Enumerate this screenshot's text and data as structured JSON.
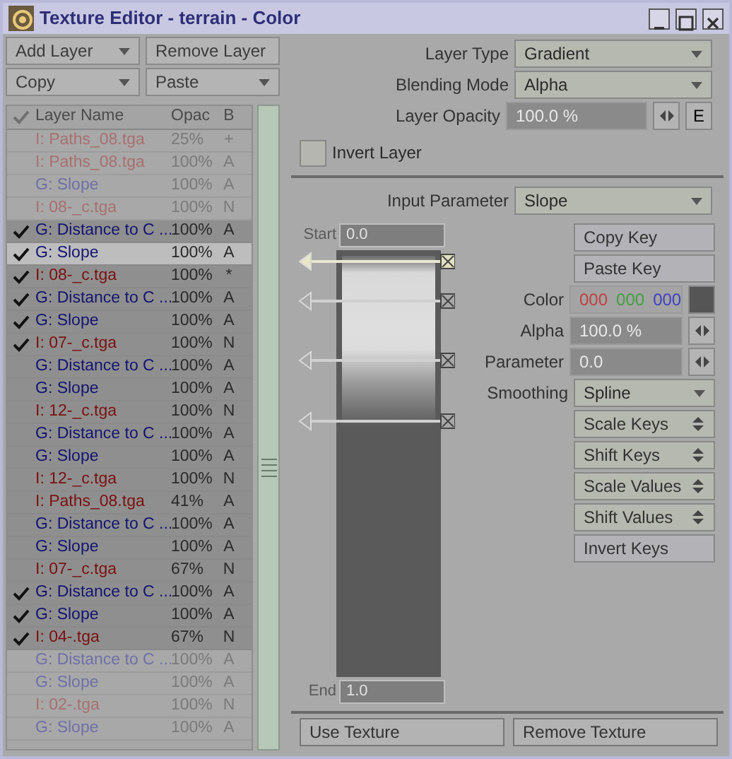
{
  "window": {
    "title": "Texture Editor - terrain - Color"
  },
  "layer_buttons": [
    {
      "label": "Add Layer",
      "kind": "dropdown"
    },
    {
      "label": "Remove Layer",
      "kind": "button"
    },
    {
      "label": "Copy",
      "kind": "dropdown"
    },
    {
      "label": "Paste",
      "kind": "dropdown"
    }
  ],
  "layer_list": {
    "columns": [
      "Layer Name",
      "Opac",
      "B"
    ],
    "rows": [
      {
        "name": "I: Paths_08.tga",
        "opacity": "25%",
        "blend": "+",
        "kind": "image",
        "checked": false,
        "selected": false,
        "dimmed": true
      },
      {
        "name": "I: Paths_08.tga",
        "opacity": "100%",
        "blend": "A",
        "kind": "image",
        "checked": false,
        "selected": false,
        "dimmed": true
      },
      {
        "name": "G: Slope",
        "opacity": "100%",
        "blend": "A",
        "kind": "gradient",
        "checked": false,
        "selected": false,
        "dimmed": true
      },
      {
        "name": "I: 08-_c.tga",
        "opacity": "100%",
        "blend": "N",
        "kind": "image",
        "checked": false,
        "selected": false,
        "dimmed": true
      },
      {
        "name": "G: Distance to C ...",
        "opacity": "100%",
        "blend": "A",
        "kind": "gradient",
        "checked": true,
        "selected": false,
        "dimmed": false
      },
      {
        "name": "G: Slope",
        "opacity": "100%",
        "blend": "A",
        "kind": "gradient",
        "checked": true,
        "selected": true,
        "dimmed": false
      },
      {
        "name": "I: 08-_c.tga",
        "opacity": "100%",
        "blend": "*",
        "kind": "image",
        "checked": true,
        "selected": false,
        "dimmed": false
      },
      {
        "name": "G: Distance to C ...",
        "opacity": "100%",
        "blend": "A",
        "kind": "gradient",
        "checked": true,
        "selected": false,
        "dimmed": false
      },
      {
        "name": "G: Slope",
        "opacity": "100%",
        "blend": "A",
        "kind": "gradient",
        "checked": true,
        "selected": false,
        "dimmed": false
      },
      {
        "name": "I: 07-_c.tga",
        "opacity": "100%",
        "blend": "N",
        "kind": "image",
        "checked": true,
        "selected": false,
        "dimmed": false
      },
      {
        "name": "G: Distance to C ...",
        "opacity": "100%",
        "blend": "A",
        "kind": "gradient",
        "checked": false,
        "selected": false,
        "dimmed": false
      },
      {
        "name": "G: Slope",
        "opacity": "100%",
        "blend": "A",
        "kind": "gradient",
        "checked": false,
        "selected": false,
        "dimmed": false
      },
      {
        "name": "I: 12-_c.tga",
        "opacity": "100%",
        "blend": "N",
        "kind": "image",
        "checked": false,
        "selected": false,
        "dimmed": false
      },
      {
        "name": "G: Distance to C ...",
        "opacity": "100%",
        "blend": "A",
        "kind": "gradient",
        "checked": false,
        "selected": false,
        "dimmed": false
      },
      {
        "name": "G: Slope",
        "opacity": "100%",
        "blend": "A",
        "kind": "gradient",
        "checked": false,
        "selected": false,
        "dimmed": false
      },
      {
        "name": "I: 12-_c.tga",
        "opacity": "100%",
        "blend": "N",
        "kind": "image",
        "checked": false,
        "selected": false,
        "dimmed": false
      },
      {
        "name": "I: Paths_08.tga",
        "opacity": "41%",
        "blend": "A",
        "kind": "image",
        "checked": false,
        "selected": false,
        "dimmed": false
      },
      {
        "name": "G: Distance to C ...",
        "opacity": "100%",
        "blend": "A",
        "kind": "gradient",
        "checked": false,
        "selected": false,
        "dimmed": false
      },
      {
        "name": "G: Slope",
        "opacity": "100%",
        "blend": "A",
        "kind": "gradient",
        "checked": false,
        "selected": false,
        "dimmed": false
      },
      {
        "name": "I: 07-_c.tga",
        "opacity": "67%",
        "blend": "N",
        "kind": "image",
        "checked": false,
        "selected": false,
        "dimmed": false
      },
      {
        "name": "G: Distance to C ...",
        "opacity": "100%",
        "blend": "A",
        "kind": "gradient",
        "checked": true,
        "selected": false,
        "dimmed": false
      },
      {
        "name": "G: Slope",
        "opacity": "100%",
        "blend": "A",
        "kind": "gradient",
        "checked": true,
        "selected": false,
        "dimmed": false
      },
      {
        "name": "I: 04-.tga",
        "opacity": "67%",
        "blend": "N",
        "kind": "image",
        "checked": true,
        "selected": false,
        "dimmed": false
      },
      {
        "name": "G: Distance to C ...",
        "opacity": "100%",
        "blend": "A",
        "kind": "gradient",
        "checked": false,
        "selected": false,
        "dimmed": true
      },
      {
        "name": "G: Slope",
        "opacity": "100%",
        "blend": "A",
        "kind": "gradient",
        "checked": false,
        "selected": false,
        "dimmed": true
      },
      {
        "name": "I: 02-.tga",
        "opacity": "100%",
        "blend": "N",
        "kind": "image",
        "checked": false,
        "selected": false,
        "dimmed": true
      },
      {
        "name": "G: Slope",
        "opacity": "100%",
        "blend": "A",
        "kind": "gradient",
        "checked": false,
        "selected": false,
        "dimmed": true
      }
    ]
  },
  "layer_settings": {
    "fields": [
      {
        "label": "Layer Type",
        "value": "Gradient",
        "kind": "dropdown"
      },
      {
        "label": "Blending Mode",
        "value": "Alpha",
        "kind": "dropdown"
      },
      {
        "label": "Layer Opacity",
        "value": "100.0 %",
        "kind": "numeric",
        "envelope": "E"
      }
    ],
    "invert_layer": {
      "label": "Invert Layer",
      "checked": false
    }
  },
  "gradient": {
    "input_parameter": {
      "label": "Input Parameter",
      "value": "Slope"
    },
    "start": {
      "label": "Start",
      "value": "0.0"
    },
    "end": {
      "label": "End",
      "value": "1.0"
    },
    "controls": [
      {
        "kind": "button",
        "label": "Copy Key"
      },
      {
        "kind": "button",
        "label": "Paste Key"
      },
      {
        "kind": "color",
        "label": "Color",
        "values": [
          "000",
          "000",
          "000"
        ]
      },
      {
        "kind": "numeric",
        "label": "Alpha",
        "value": "100.0 %"
      },
      {
        "kind": "numeric",
        "label": "Parameter",
        "value": "0.0"
      },
      {
        "kind": "dropdown",
        "label": "Smoothing",
        "value": "Spline"
      },
      {
        "kind": "spinner",
        "label": "Scale Keys"
      },
      {
        "kind": "spinner",
        "label": "Shift Keys"
      },
      {
        "kind": "spinner",
        "label": "Scale Values"
      },
      {
        "kind": "spinner",
        "label": "Shift Values"
      },
      {
        "kind": "button",
        "label": "Invert Keys"
      }
    ]
  },
  "footer_buttons": [
    "Use Texture",
    "Remove Texture"
  ]
}
